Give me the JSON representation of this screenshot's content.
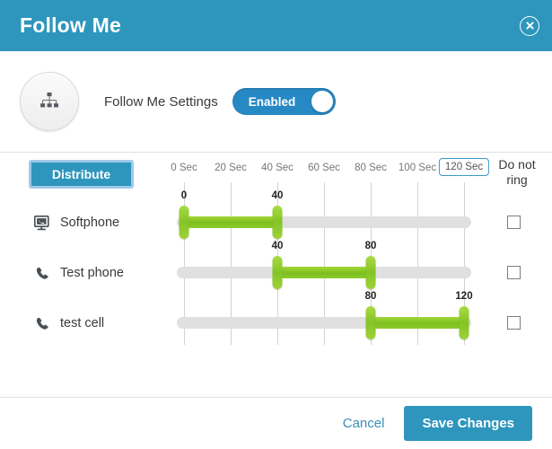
{
  "header": {
    "title": "Follow Me",
    "close_icon": "close-circle-icon"
  },
  "settings": {
    "avatar_icon": "sitemap-icon",
    "label": "Follow Me Settings",
    "toggle": {
      "state_label": "Enabled",
      "enabled": true
    }
  },
  "scheduler": {
    "distribute_label": "Distribute",
    "do_not_ring_header": "Do not ring",
    "axis": {
      "min": 0,
      "max": 120,
      "unit": "Sec",
      "tick_values": [
        0,
        20,
        40,
        60,
        80,
        100,
        120
      ],
      "tick_labels": [
        "0 Sec",
        "20 Sec",
        "40 Sec",
        "60 Sec",
        "80 Sec",
        "100 Sec",
        "120 Sec"
      ],
      "highlighted_tick_index": 6
    },
    "rows": [
      {
        "icon": "desktop-phone-icon",
        "label": "Softphone",
        "start": 0,
        "end": 40,
        "start_label": "0",
        "end_label": "40",
        "do_not_ring": false
      },
      {
        "icon": "phone-handset-icon",
        "label": "Test phone",
        "start": 40,
        "end": 80,
        "start_label": "40",
        "end_label": "80",
        "do_not_ring": false
      },
      {
        "icon": "phone-handset-icon",
        "label": "test cell",
        "start": 80,
        "end": 120,
        "start_label": "80",
        "end_label": "120",
        "do_not_ring": false
      }
    ]
  },
  "footer": {
    "cancel_label": "Cancel",
    "save_label": "Save Changes"
  },
  "colors": {
    "header_blue": "#2e96bd",
    "toggle_blue": "#2789c4",
    "slider_green": "#84c426",
    "track_grey": "#e0e0e0",
    "link_blue": "#3b8fb5"
  }
}
